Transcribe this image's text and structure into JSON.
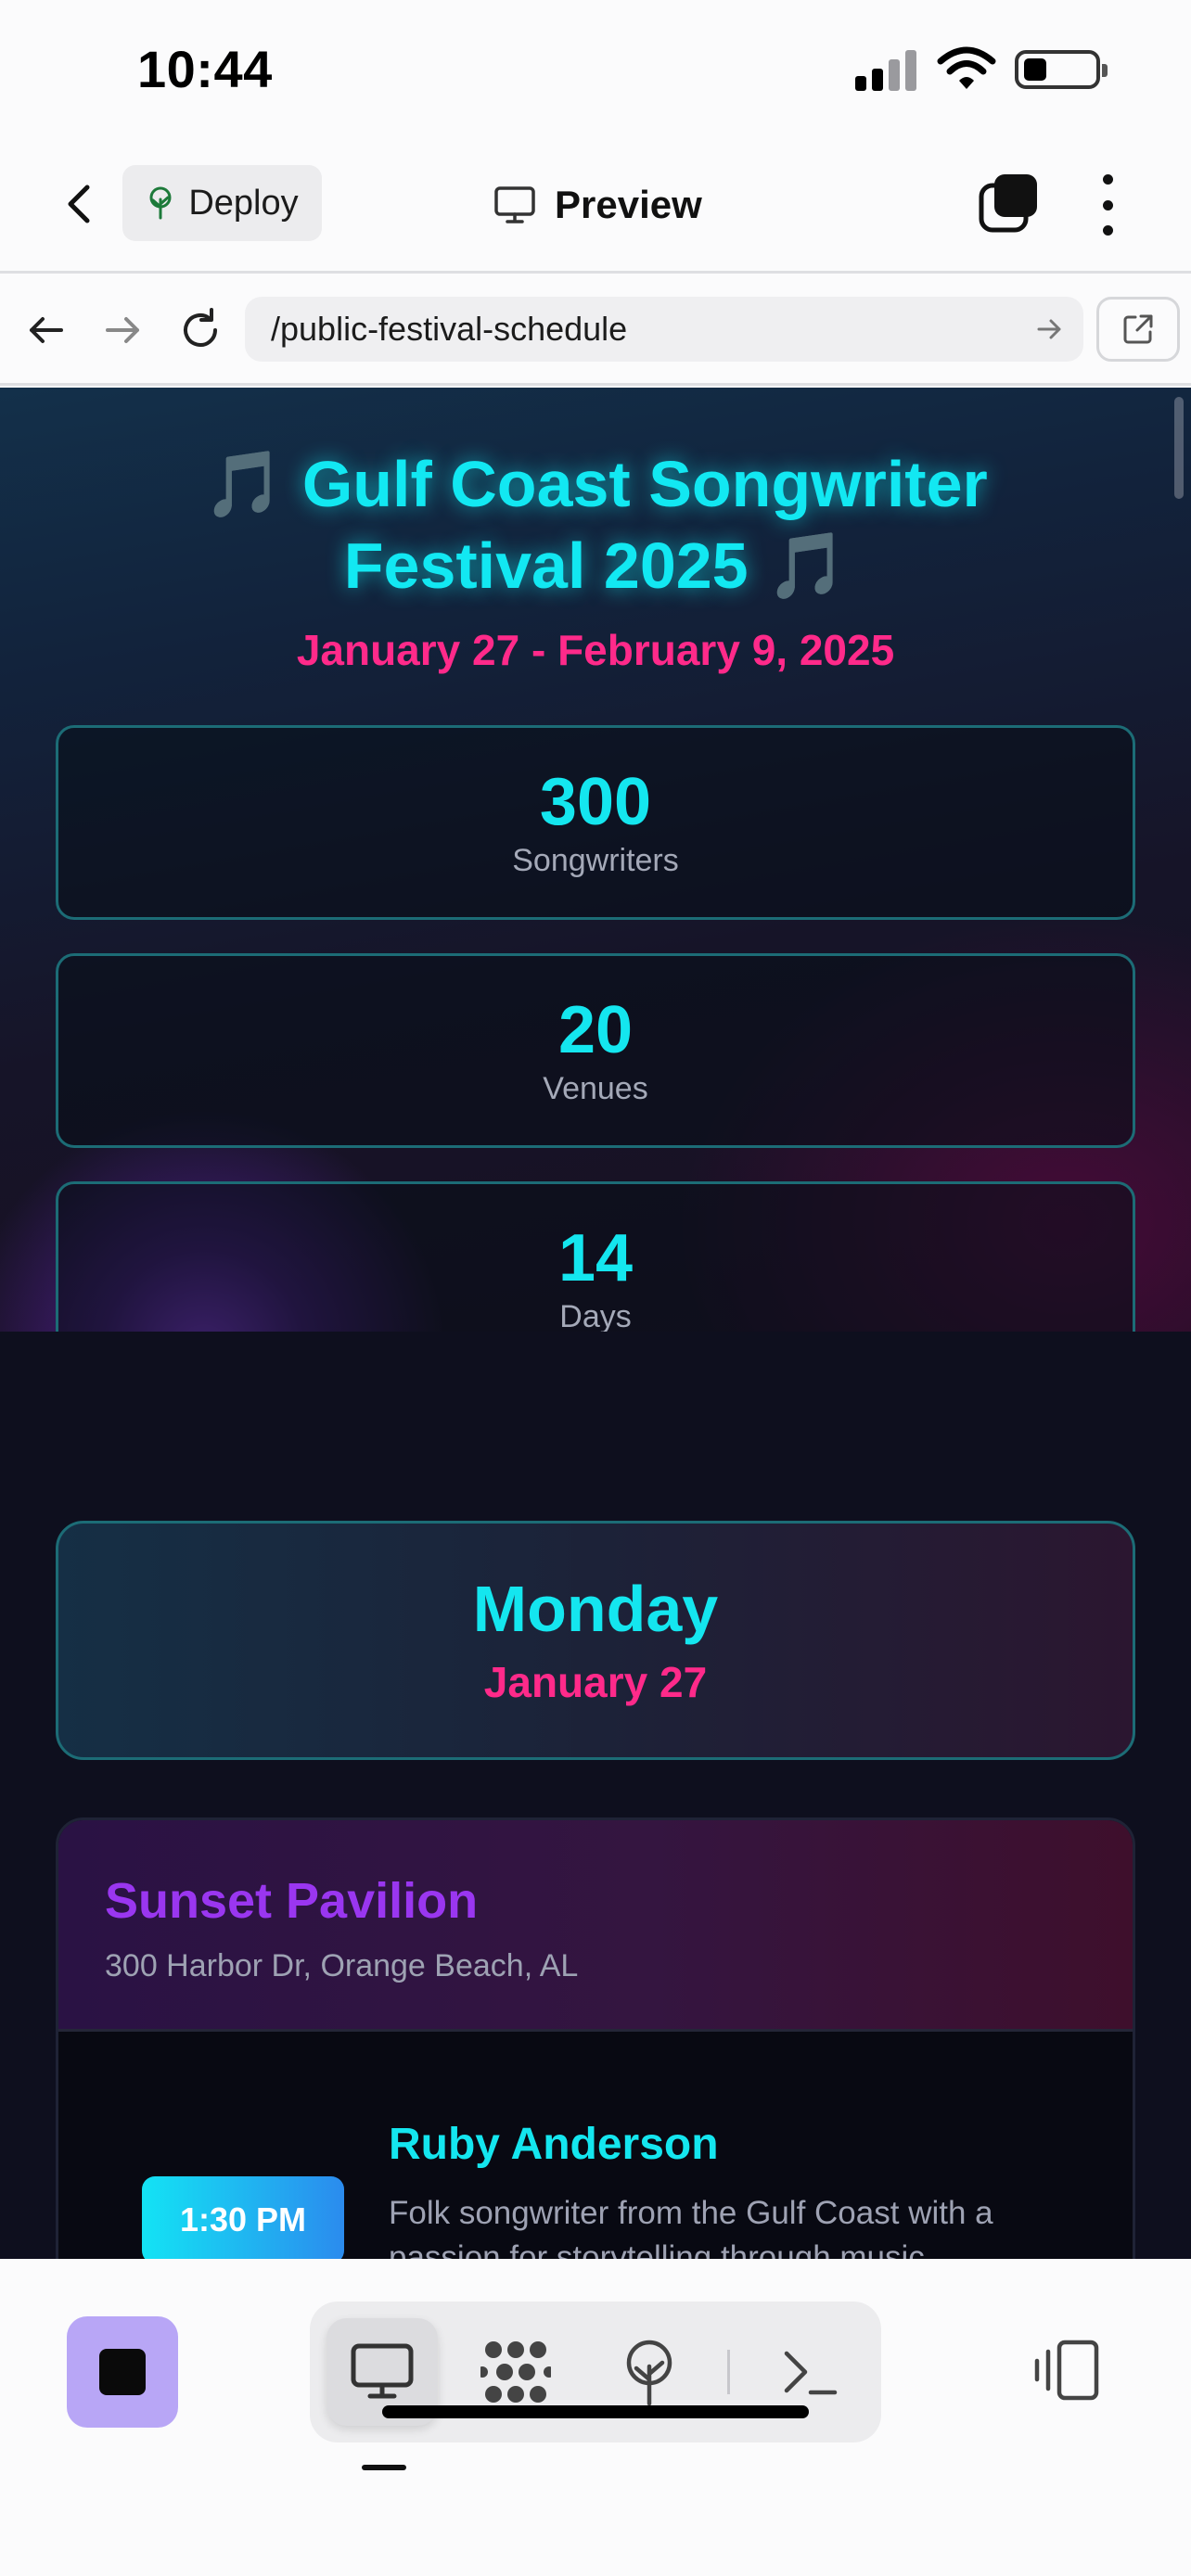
{
  "status_bar": {
    "time": "10:44"
  },
  "header": {
    "deploy_label": "Deploy",
    "preview_label": "Preview"
  },
  "browser": {
    "url": "/public-festival-schedule"
  },
  "festival": {
    "title_line1": "Gulf Coast Songwriter",
    "title_line2": "Festival 2025",
    "note_glyph": "🎵",
    "dates": "January 27 - February 9, 2025",
    "stats": [
      {
        "value": "300",
        "label": "Songwriters"
      },
      {
        "value": "20",
        "label": "Venues"
      },
      {
        "value": "14",
        "label": "Days"
      }
    ]
  },
  "schedule": {
    "day_name": "Monday",
    "day_date": "January 27",
    "venue": {
      "name": "Sunset Pavilion",
      "address": "300 Harbor Dr, Orange Beach, AL",
      "performances": [
        {
          "time": "1:30 PM",
          "artist": "Ruby Anderson",
          "description": "Folk songwriter from the Gulf Coast with a passion for storytelling through music."
        }
      ]
    }
  },
  "colors": {
    "accent_cyan": "#14e6ef",
    "accent_pink": "#ff2a8a",
    "accent_purple": "#9a36f0",
    "stop_button": "#b8a6f6"
  },
  "icons": {
    "header": [
      "chevron-left-icon",
      "tree-icon",
      "monitor-icon",
      "tabs-icon",
      "more-vertical-icon"
    ],
    "browser": [
      "arrow-left-icon",
      "arrow-right-icon",
      "reload-icon",
      "arrow-right-small-icon",
      "external-link-icon"
    ],
    "toolbar": [
      "stop-icon",
      "monitor-icon",
      "grid-dots-icon",
      "tree-icon",
      "terminal-icon",
      "device-toggle-icon"
    ]
  }
}
